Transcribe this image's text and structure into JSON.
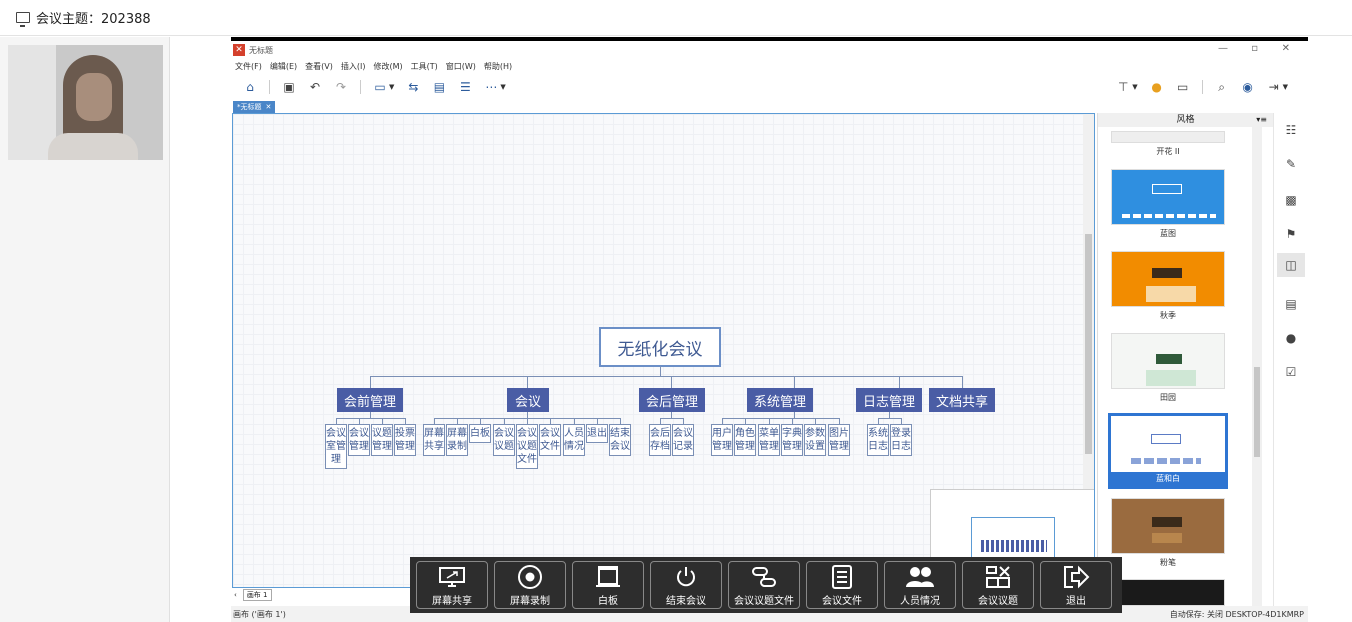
{
  "topbar": {
    "title": "会议主题：202388"
  },
  "app": {
    "title": "无标题",
    "menu": [
      "文件(F)",
      "编辑(E)",
      "查看(V)",
      "插入(I)",
      "修改(M)",
      "工具(T)",
      "窗口(W)",
      "帮助(H)"
    ],
    "tab": "*无标题"
  },
  "mindmap": {
    "root": "无纸化会议",
    "branches": [
      {
        "label": "会前管理",
        "children": [
          "会议室管理",
          "会议管理",
          "议题管理",
          "投票管理"
        ]
      },
      {
        "label": "会议",
        "children": [
          "屏幕共享",
          "屏幕录制",
          "白板",
          "会议议题",
          "会议议题文件",
          "会议文件",
          "人员情况",
          "退出",
          "结束会议"
        ]
      },
      {
        "label": "会后管理",
        "children": [
          "会后存档",
          "会议记录"
        ]
      },
      {
        "label": "系统管理",
        "children": [
          "用户管理",
          "角色管理",
          "菜单管理",
          "字典管理",
          "参数设置",
          "图片管理"
        ]
      },
      {
        "label": "日志管理",
        "children": [
          "系统日志",
          "登录日志"
        ]
      },
      {
        "label": "文档共享",
        "children": []
      }
    ]
  },
  "canvas_footer": {
    "sheet": "画布 1"
  },
  "statusbar": {
    "left": "画布 ('画布 1')",
    "right": "自动保存: 关闭   DESKTOP-4D1KMRP"
  },
  "style_panel": {
    "title": "风格",
    "themes": [
      "开花 II",
      "蓝图",
      "秋季",
      "田园",
      "蓝和白",
      "粉笔"
    ],
    "selected": "蓝和白"
  },
  "bottom_bar": {
    "buttons": [
      "屏幕共享",
      "屏幕录制",
      "白板",
      "结束会议",
      "会议议题文件",
      "会议文件",
      "人员情况",
      "会议议题",
      "退出"
    ]
  }
}
